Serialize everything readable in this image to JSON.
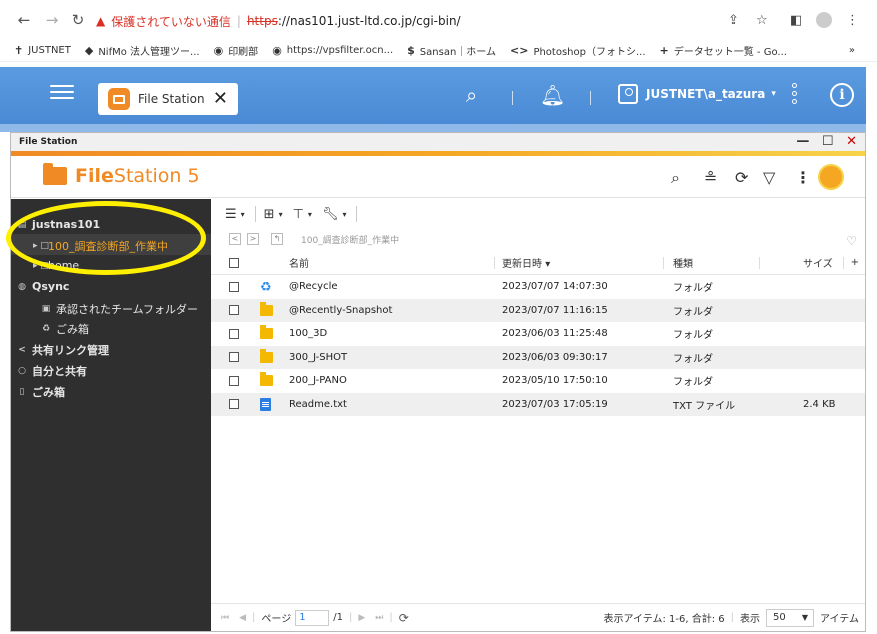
{
  "browser": {
    "omnibox": {
      "security": "保護されていない通信",
      "https": "https",
      "url": "://nas101.just-ltd.co.jp/cgi-bin/"
    },
    "bookmarks": [
      {
        "icon": "✝",
        "label": "JUSTNET"
      },
      {
        "icon": "◆",
        "label": "NifMo 法人管理ツー..."
      },
      {
        "icon": "◉",
        "label": "印刷部"
      },
      {
        "icon": "◉",
        "label": "https://vpsfilter.ocn..."
      },
      {
        "icon": "$",
        "label": "Sansan｜ホーム"
      },
      {
        "icon": "<>",
        "label": "Photoshop（フォトシ..."
      },
      {
        "icon": "+",
        "label": "データセット一覧 - Go..."
      }
    ],
    "bookmarks_more": "»"
  },
  "qts": {
    "tab_label": "File Station",
    "user": "JUSTNET\\a_tazura",
    "user_caret": "▾"
  },
  "window": {
    "title": "File Station",
    "logo_bold": "File",
    "logo_rest": "Station 5"
  },
  "sidebar": {
    "items": [
      {
        "label": "justnas101",
        "icon": "▤",
        "bold": true
      },
      {
        "label": "100_調査診断部_作業中",
        "icon": "▸ □",
        "selected": true
      },
      {
        "label": "home",
        "icon": "▸ □"
      },
      {
        "label": "Qsync",
        "icon": "◍",
        "bold": true
      },
      {
        "label": "承認されたチームフォルダー",
        "icon": "▣"
      },
      {
        "label": "ごみ箱",
        "icon": "♻"
      },
      {
        "label": "共有リンク管理",
        "icon": "<",
        "bold": true
      },
      {
        "label": "自分と共有",
        "icon": "○",
        "bold": true
      },
      {
        "label": "ごみ箱",
        "icon": "▯",
        "bold": true
      }
    ]
  },
  "toolbar": {
    "path": "100_調査診断部_作業中"
  },
  "table": {
    "headers": {
      "name": "名前",
      "date": "更新日時",
      "date_sort": "▾",
      "type": "種類",
      "size": "サイズ",
      "plus": "+"
    },
    "rows": [
      {
        "name": "@Recycle",
        "date": "2023/07/07 14:07:30",
        "type": "フォルダ",
        "size": "",
        "icon": "recycle-icon"
      },
      {
        "name": "@Recently-Snapshot",
        "date": "2023/07/07 11:16:15",
        "type": "フォルダ",
        "size": "",
        "icon": "folder-icon"
      },
      {
        "name": "100_3D",
        "date": "2023/06/03 11:25:48",
        "type": "フォルダ",
        "size": "",
        "icon": "folder-icon"
      },
      {
        "name": "300_J-SHOT",
        "date": "2023/06/03 09:30:17",
        "type": "フォルダ",
        "size": "",
        "icon": "folder-icon"
      },
      {
        "name": "200_J-PANO",
        "date": "2023/05/10 17:50:10",
        "type": "フォルダ",
        "size": "",
        "icon": "folder-icon"
      },
      {
        "name": "Readme.txt",
        "date": "2023/07/03 17:05:19",
        "type": "TXT ファイル",
        "size": "2.4 KB",
        "icon": "txt-file-icon"
      }
    ]
  },
  "pager": {
    "page_label": "ページ",
    "page": "1",
    "total": "/1",
    "items_info": "表示アイテム: 1-6, 合計: 6",
    "show_label": "表示",
    "per_page": "50",
    "items_label": "アイテム"
  },
  "colors": {
    "accent": "#f08a24",
    "header": "#4a8ad6",
    "highlight": "#ffef00"
  }
}
